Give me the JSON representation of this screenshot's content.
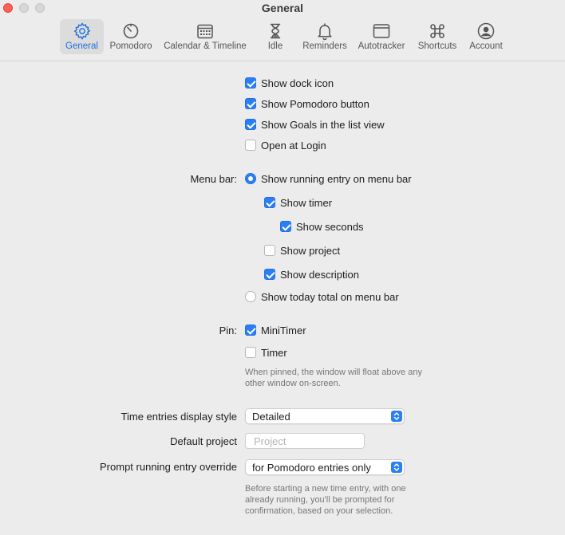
{
  "window": {
    "title": "General"
  },
  "tabs": [
    {
      "label": "General",
      "icon": "gear-icon",
      "active": true
    },
    {
      "label": "Pomodoro",
      "icon": "timer-icon",
      "active": false
    },
    {
      "label": "Calendar & Timeline",
      "icon": "calendar-icon",
      "active": false
    },
    {
      "label": "Idle",
      "icon": "hourglass-icon",
      "active": false
    },
    {
      "label": "Reminders",
      "icon": "bell-icon",
      "active": false
    },
    {
      "label": "Autotracker",
      "icon": "window-icon",
      "active": false
    },
    {
      "label": "Shortcuts",
      "icon": "command-icon",
      "active": false
    },
    {
      "label": "Account",
      "icon": "person-circle-icon",
      "active": false
    }
  ],
  "general_options": [
    {
      "label": "Show dock icon",
      "checked": true
    },
    {
      "label": "Show Pomodoro button",
      "checked": true
    },
    {
      "label": "Show Goals in the list view",
      "checked": true
    },
    {
      "label": "Open at Login",
      "checked": false
    }
  ],
  "menu_bar": {
    "label": "Menu bar:",
    "show_running_entry": {
      "label": "Show running entry on menu bar",
      "selected": true
    },
    "show_timer": {
      "label": "Show timer",
      "checked": true
    },
    "show_seconds": {
      "label": "Show seconds",
      "checked": true
    },
    "show_project": {
      "label": "Show project",
      "checked": false
    },
    "show_description": {
      "label": "Show description",
      "checked": true
    },
    "show_today_total": {
      "label": "Show today total on menu bar",
      "selected": false
    }
  },
  "pin": {
    "label": "Pin:",
    "minitimer": {
      "label": "MiniTimer",
      "checked": true
    },
    "timer": {
      "label": "Timer",
      "checked": false
    },
    "note_line1": "When pinned, the window will float above any",
    "note_line2": "other window on-screen."
  },
  "display_style": {
    "label": "Time entries display style",
    "value": "Detailed"
  },
  "default_project": {
    "label": "Default project",
    "placeholder": "Project"
  },
  "prompt_override": {
    "label": "Prompt running entry override",
    "value": "for Pomodoro entries only",
    "note_line1": "Before starting a new time entry, with one",
    "note_line2": "already running, you'll be prompted for",
    "note_line3": "confirmation, based on your selection."
  },
  "colors": {
    "accent": "#2b7ef4",
    "close": "#fe5f57"
  }
}
